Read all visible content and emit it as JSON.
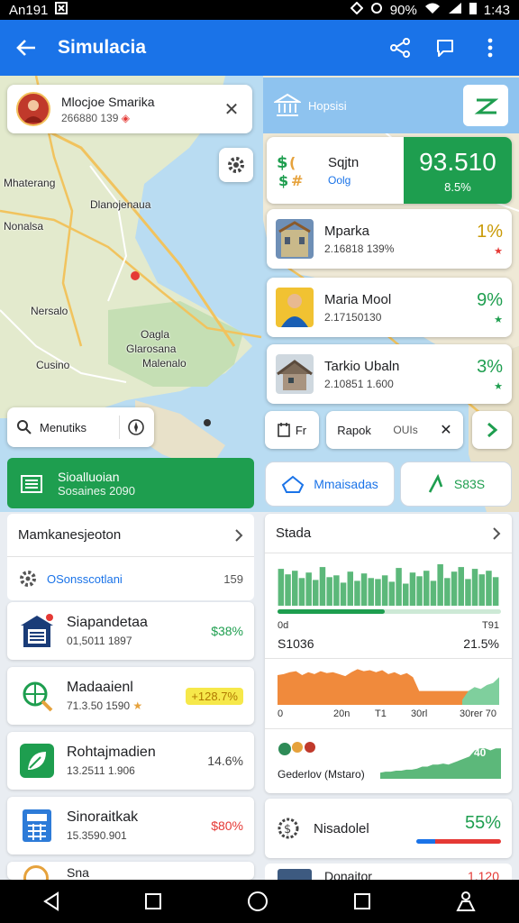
{
  "status_bar": {
    "carrier": "An191",
    "battery": "90%",
    "time": "1:43"
  },
  "app_bar": {
    "title": "Simulacia"
  },
  "map": {
    "labels": [
      "Dlanojenaua",
      "Nonalsa",
      "Nersalo",
      "Oagla",
      "Glarosana",
      "Malenalo",
      "Cusino",
      "Mhaterang"
    ]
  },
  "user_card": {
    "name": "Mlocjoe Smarika",
    "sub": "266880 139"
  },
  "search": {
    "label": "Menutiks"
  },
  "green_bar": {
    "title": "Sioalluoian",
    "subtitle": "Sosaines 2090"
  },
  "right_head": {
    "label": "Hopsisi"
  },
  "assets": [
    {
      "name": "Sqjtn",
      "sub": "Oolg",
      "big_value": "93.510",
      "big_pct": "8.5%"
    },
    {
      "name": "Mparka",
      "sub": "2.16818 139%",
      "pct": "1%",
      "mark": "★",
      "pct_color": "#c99a06",
      "mark_color": "#e53935"
    },
    {
      "name": "Maria Mool",
      "sub": "2.17150130",
      "pct": "9%",
      "mark": "★",
      "pct_color": "#1e9e4f",
      "mark_color": "#1e9e4f"
    },
    {
      "name": "Tarkio Ubaln",
      "sub": "2.10851 1.600",
      "pct": "3%",
      "mark": "★",
      "pct_color": "#1e9e4f",
      "mark_color": "#1e9e4f"
    }
  ],
  "chips": {
    "a": "Fr",
    "b": "Rapok",
    "c": "OUIs"
  },
  "pills": {
    "left": "Mmaisadas",
    "right": "S83S"
  },
  "list_section": {
    "title": "Mamkanesjeoton",
    "sub_label": "OSonsscotlani",
    "sub_value": "159"
  },
  "list_items": [
    {
      "name": "Siapandetaa",
      "sub": "01,5011 1897",
      "value": "$38%",
      "value_color": "#1e9e4f"
    },
    {
      "name": "Madaaienl",
      "sub": "71.3.50 1590",
      "value": "+128.7%",
      "value_color": "#b07800"
    },
    {
      "name": "Rohtajmadien",
      "sub": "13.2511 1.906",
      "value": "14.6%",
      "value_color": "#444"
    },
    {
      "name": "Sinoraitkak",
      "sub": "15.3590.901",
      "value": "$80%",
      "value_color": "#e53935"
    },
    {
      "name": "Sna",
      "sub": "",
      "value": "",
      "value_color": "#444"
    }
  ],
  "stats_panel": {
    "title": "Stada",
    "bar_left": "0d",
    "bar_right": "T91",
    "value_left": "S1036",
    "value_right": "21.5%",
    "axis_ticks": [
      "0",
      "20n",
      "T1",
      "30rl",
      "30rer 70"
    ],
    "footer_label": "Gederlov (Mstaro)",
    "area_label": "40"
  },
  "bottom_card": {
    "label": "Nisadolel",
    "value": "55%"
  },
  "partial_row": {
    "label": "Donaitor",
    "value": "1.120"
  },
  "chart_data": [
    {
      "type": "bar",
      "title": "",
      "values": [
        40,
        34,
        38,
        30,
        36,
        28,
        42,
        31,
        33,
        25,
        37,
        27,
        35,
        30,
        29,
        33,
        26,
        41,
        24,
        36,
        32,
        38,
        27,
        45,
        30,
        37,
        42,
        29,
        40,
        34,
        38,
        31
      ]
    },
    {
      "type": "area",
      "series": [
        {
          "values": [
            30,
            31,
            33,
            34,
            30,
            33,
            31,
            34,
            32,
            33,
            31,
            29,
            33,
            36,
            34,
            35,
            33,
            35,
            31,
            33,
            30,
            32,
            28,
            14,
            14,
            14,
            14,
            14,
            14,
            14,
            14,
            14,
            14,
            14,
            14,
            14,
            14
          ]
        },
        {
          "values": [
            null,
            null,
            null,
            null,
            null,
            null,
            null,
            null,
            null,
            null,
            null,
            null,
            null,
            null,
            null,
            null,
            null,
            null,
            null,
            null,
            null,
            null,
            null,
            null,
            null,
            null,
            null,
            null,
            null,
            null,
            5,
            14,
            18,
            16,
            20,
            22,
            28
          ]
        }
      ]
    },
    {
      "type": "area",
      "values": [
        6,
        7,
        7,
        8,
        8,
        9,
        9,
        10,
        12,
        12,
        14,
        14,
        15,
        14,
        16,
        18,
        20,
        22,
        28,
        30,
        30,
        28,
        30,
        30
      ]
    }
  ]
}
